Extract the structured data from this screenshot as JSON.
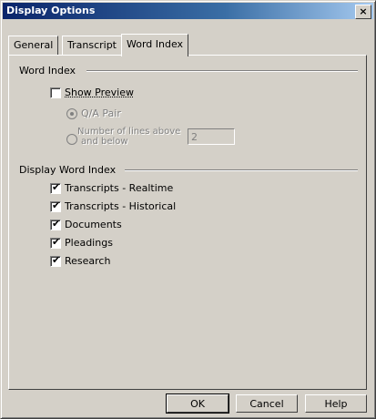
{
  "window": {
    "title": "Display Options",
    "close_glyph": "×"
  },
  "tabs": [
    {
      "label": "General"
    },
    {
      "label": "Transcript"
    },
    {
      "label": "Word Index"
    }
  ],
  "word_index_group": {
    "label": "Word Index",
    "show_preview_label": "Show Preview",
    "show_preview_checked": false,
    "qa_pair_label": "Q/A Pair",
    "lines_label_line1": "Number of lines above",
    "lines_label_line2": "and below",
    "lines_value": "2"
  },
  "display_group": {
    "label": "Display Word Index",
    "items": [
      {
        "label": "Transcripts - Realtime",
        "checked": true
      },
      {
        "label": "Transcripts - Historical",
        "checked": true
      },
      {
        "label": "Documents",
        "checked": true
      },
      {
        "label": "Pleadings",
        "checked": true
      },
      {
        "label": "Research",
        "checked": true
      }
    ]
  },
  "buttons": {
    "ok": "OK",
    "cancel": "Cancel",
    "help": "Help"
  },
  "check_glyph": "✔"
}
